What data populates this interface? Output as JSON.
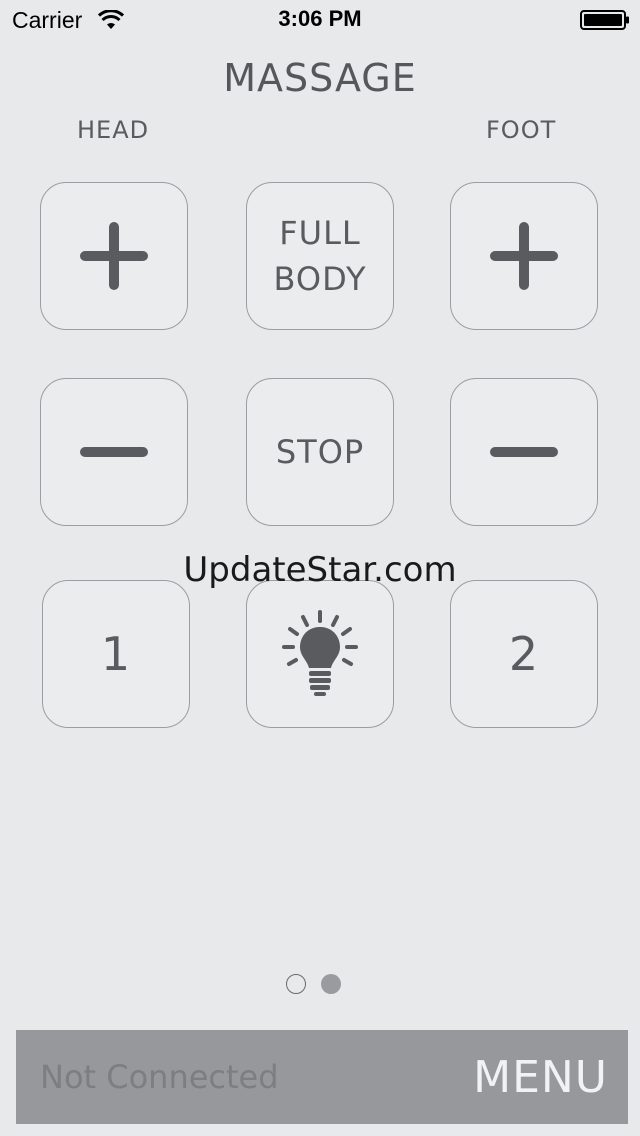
{
  "status_bar": {
    "carrier": "Carrier",
    "time": "3:06 PM"
  },
  "header": {
    "title": "MASSAGE",
    "head_label": "HEAD",
    "foot_label": "FOOT"
  },
  "buttons": {
    "full_body": "FULL BODY",
    "stop": "STOP",
    "preset_1": "1",
    "preset_2": "2"
  },
  "icons": {
    "head_up": "plus-icon",
    "foot_up": "plus-icon",
    "head_down": "minus-icon",
    "foot_down": "minus-icon",
    "light": "lightbulb-icon"
  },
  "watermark": "UpdateStar.com",
  "pager": {
    "current_page": 2,
    "total_pages": 2
  },
  "bottom_bar": {
    "status": "Not Connected",
    "menu_label": "MENU"
  },
  "colors": {
    "background": "#e8e9eb",
    "icon_fill": "#5a5b5f",
    "bottom_bar": "#97989c",
    "menu_text": "#f2f2f4"
  }
}
